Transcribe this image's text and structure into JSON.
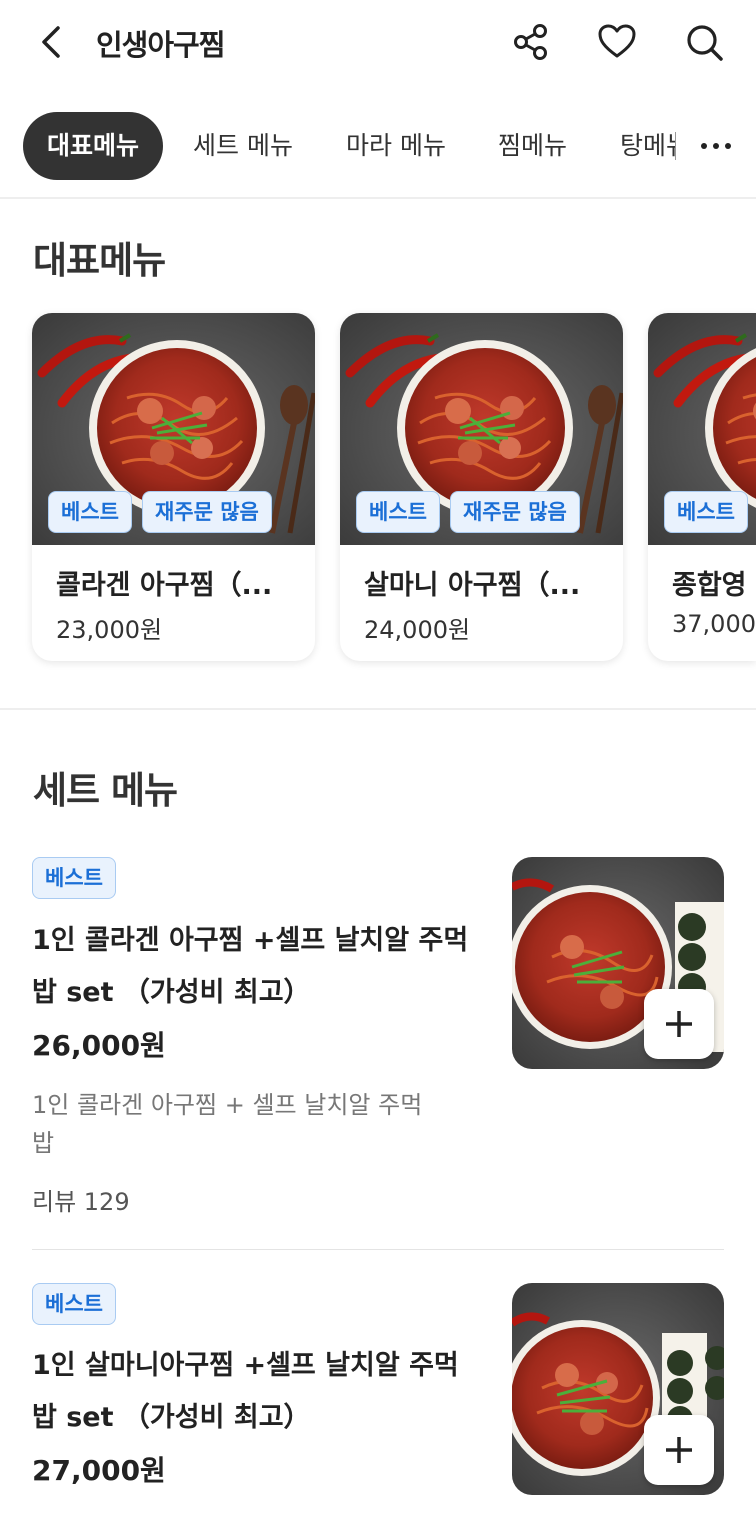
{
  "header": {
    "title": "인생아구찜"
  },
  "tabs": [
    {
      "label": "대표메뉴",
      "active": true
    },
    {
      "label": "세트 메뉴",
      "active": false
    },
    {
      "label": "마라 메뉴",
      "active": false
    },
    {
      "label": "찜메뉴",
      "active": false
    },
    {
      "label": "탕메뉴",
      "active": false
    }
  ],
  "featured": {
    "title": "대표메뉴",
    "items": [
      {
        "name": "콜라겐 아구찜（...",
        "price": "23,000원",
        "badges": [
          "베스트",
          "재주문 많음"
        ]
      },
      {
        "name": "살마니 아구찜（...",
        "price": "24,000원",
        "badges": [
          "베스트",
          "재주문 많음"
        ]
      },
      {
        "name": "종합영",
        "price": "37,000",
        "badges": [
          "베스트"
        ]
      }
    ]
  },
  "set_menu": {
    "title": "세트 메뉴",
    "items": [
      {
        "badge": "베스트",
        "name": "1인 콜라겐 아구찜 +셀프 날치알 주먹밥 set （가성비 최고）",
        "price": "26,000원",
        "description": "1인 콜라겐 아구찜 + 셀프 날치알 주먹밥",
        "review": "리뷰 129"
      },
      {
        "badge": "베스트",
        "name": "1인 살마니아구찜 +셀프 날치알 주먹밥 set （가성비 최고）",
        "price": "27,000원"
      }
    ]
  },
  "colors": {
    "badge_text": "#1b6fd6",
    "badge_bg": "#e9f2fd",
    "active_tab": "#333333"
  },
  "icons": [
    "back-arrow-icon",
    "share-icon",
    "heart-icon",
    "search-icon",
    "more-icon",
    "plus-icon"
  ]
}
